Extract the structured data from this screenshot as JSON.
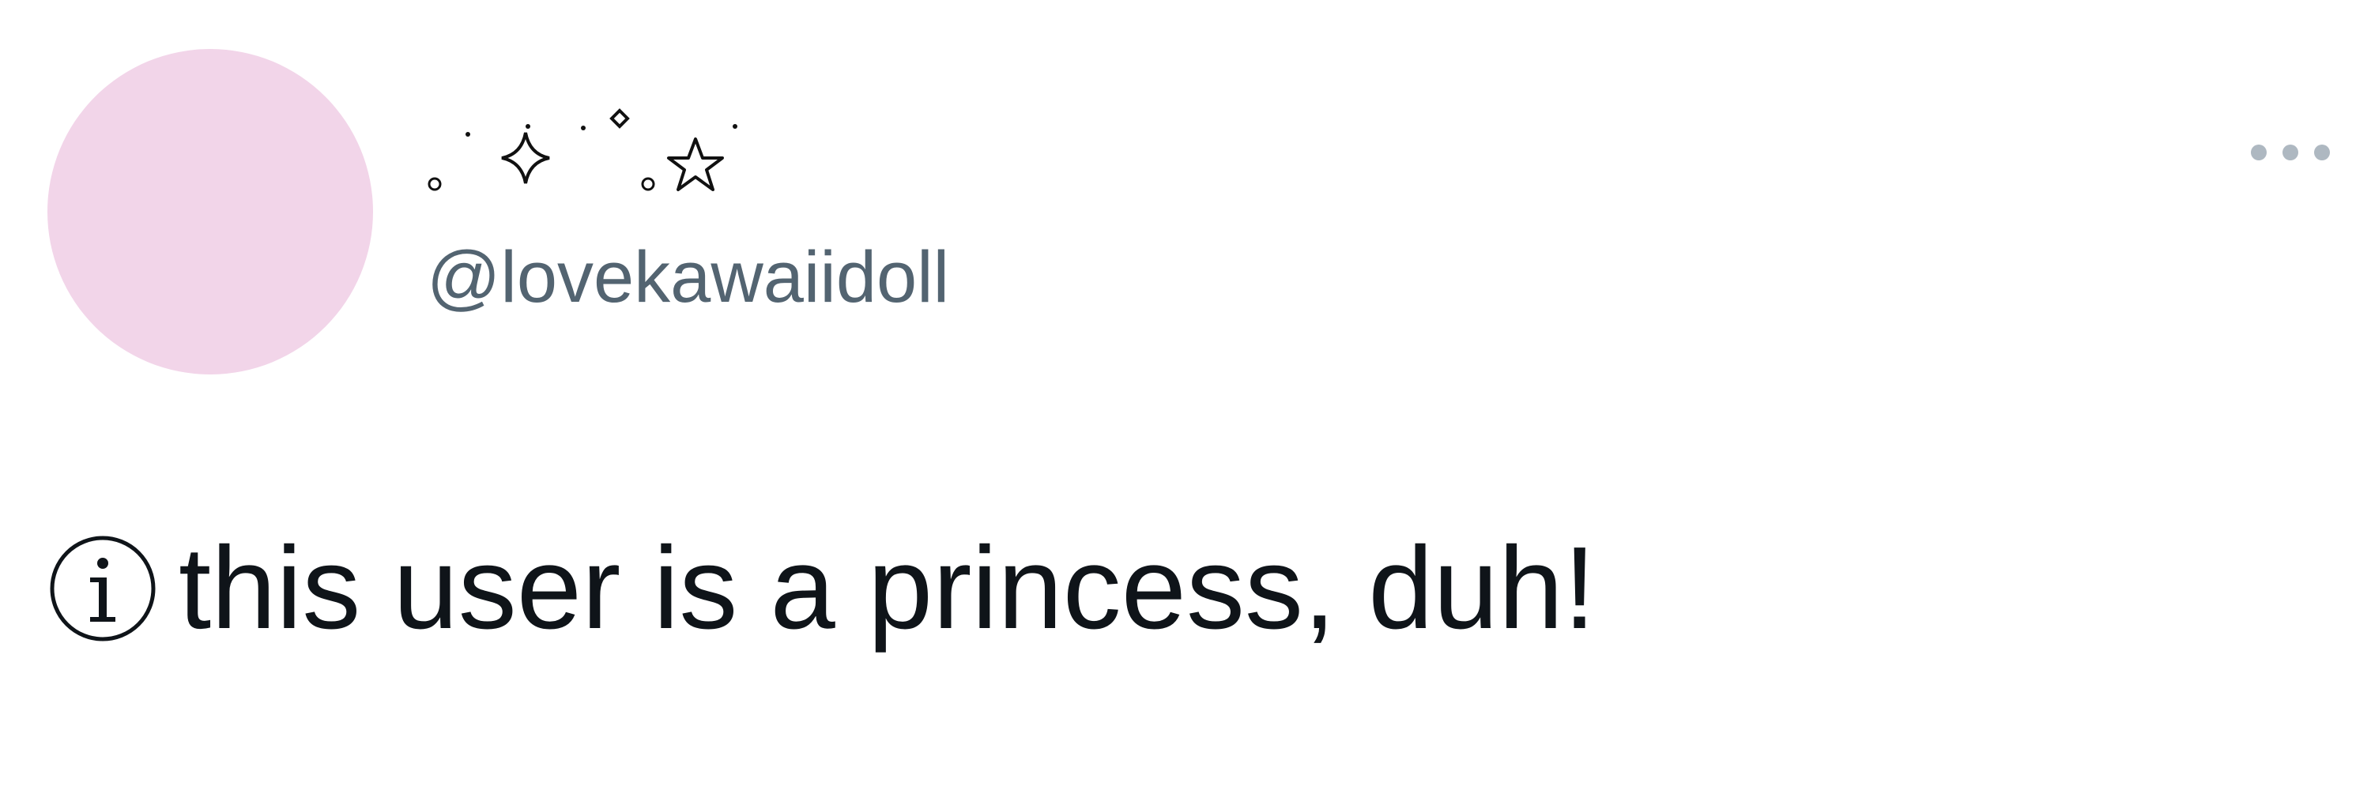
{
  "tweet": {
    "author": {
      "display_name_symbols": "˚✧ ˚ ☆",
      "handle": "@lovekawaiidoll",
      "avatar_color": "#f2d5e9"
    },
    "more_icon": "more-horizontal-icon",
    "notice": {
      "icon": "info-circle-icon",
      "text": "this user is a princess, duh!"
    }
  },
  "colors": {
    "handle": "#536471",
    "text": "#0f1419",
    "more_dots": "#aeb8c1"
  }
}
